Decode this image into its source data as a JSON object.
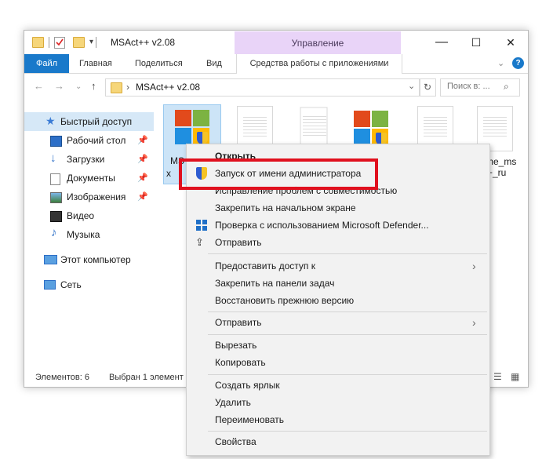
{
  "window": {
    "title": "MSAct++ v2.08",
    "context_tab_label": "Управление",
    "controls": {
      "minimize": "—",
      "maximize": "☐",
      "close": "✕"
    }
  },
  "ribbon": {
    "tabs": [
      "Файл",
      "Главная",
      "Поделиться",
      "Вид"
    ],
    "apptools_label": "Средства работы с приложениями"
  },
  "address": {
    "path": "MSAct++ v2.08",
    "search_placeholder": "Поиск в: ..."
  },
  "sidebar": {
    "items": [
      {
        "label": "Быстрый доступ",
        "pinned": false
      },
      {
        "label": "Рабочий стол",
        "pinned": true
      },
      {
        "label": "Загрузки",
        "pinned": true
      },
      {
        "label": "Документы",
        "pinned": true
      },
      {
        "label": "Изображения",
        "pinned": true
      },
      {
        "label": "Видео",
        "pinned": false
      },
      {
        "label": "Музыка",
        "pinned": false
      },
      {
        "label": "Этот компьютер",
        "pinned": false
      },
      {
        "label": "Сеть",
        "pinned": false
      }
    ]
  },
  "files": {
    "partial_name_1": "MS",
    "partial_name_1b": "x",
    "partial_name_2": "me_ms",
    "partial_name_2b": "+_ru"
  },
  "statusbar": {
    "count": "Элементов: 6",
    "selected": "Выбран 1 элемент"
  },
  "context_menu": {
    "items": [
      {
        "label": "Открыть",
        "icon": "",
        "submenu": false
      },
      {
        "label": "Запуск от имени администратора",
        "icon": "uac-shield-icon",
        "submenu": false
      },
      {
        "label": "Исправление проблем с совместимостью",
        "icon": "",
        "submenu": false
      },
      {
        "label": "Закрепить на начальном экране",
        "icon": "",
        "submenu": false
      },
      {
        "label": "Проверка с использованием Microsoft Defender...",
        "icon": "defender-icon",
        "submenu": false
      },
      {
        "label": "Отправить",
        "icon": "share-icon",
        "submenu": false
      },
      {
        "label": "Предоставить доступ к",
        "icon": "",
        "submenu": true
      },
      {
        "label": "Закрепить на панели задач",
        "icon": "",
        "submenu": false
      },
      {
        "label": "Восстановить прежнюю версию",
        "icon": "",
        "submenu": false
      },
      {
        "label": "Отправить",
        "icon": "",
        "submenu": true
      },
      {
        "label": "Вырезать",
        "icon": "",
        "submenu": false
      },
      {
        "label": "Копировать",
        "icon": "",
        "submenu": false
      },
      {
        "label": "Создать ярлык",
        "icon": "",
        "submenu": false
      },
      {
        "label": "Удалить",
        "icon": "",
        "submenu": false
      },
      {
        "label": "Переименовать",
        "icon": "",
        "submenu": false
      },
      {
        "label": "Свойства",
        "icon": "",
        "submenu": false
      }
    ]
  },
  "colors": {
    "file_tab": "#1979ca",
    "context_tab": "#e9d4f8",
    "highlight_border": "#e0101e",
    "sidebar_active": "#d6e8f7"
  }
}
